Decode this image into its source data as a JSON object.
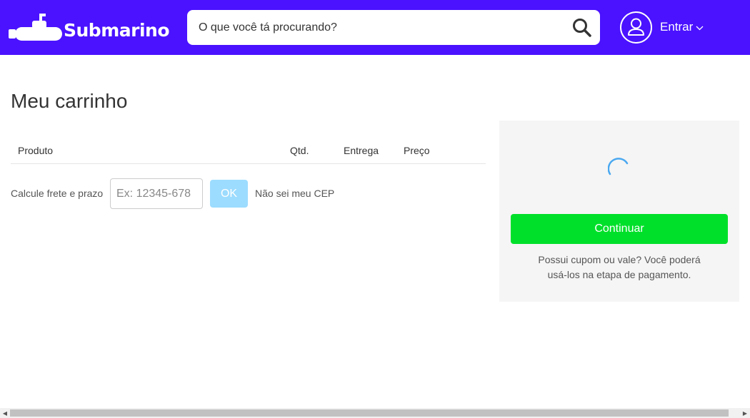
{
  "header": {
    "brand": "Submarino",
    "search_placeholder": "O que você tá procurando?",
    "login_label": "Entrar",
    "background_color": "#4a12ff"
  },
  "page": {
    "title": "Meu carrinho"
  },
  "cart_table": {
    "columns": [
      "Produto",
      "Qtd.",
      "Entrega",
      "Preço"
    ]
  },
  "shipping": {
    "label": "Calcule frete e prazo",
    "input_placeholder": "Ex: 12345-678",
    "ok_label": "OK",
    "unknown_cep_link": "Não sei meu CEP"
  },
  "summary": {
    "continue_label": "Continuar",
    "coupon_line1": "Possui cupom ou vale? Você poderá",
    "coupon_line2": "usá-los na etapa de pagamento.",
    "continue_color": "#00e02a"
  }
}
